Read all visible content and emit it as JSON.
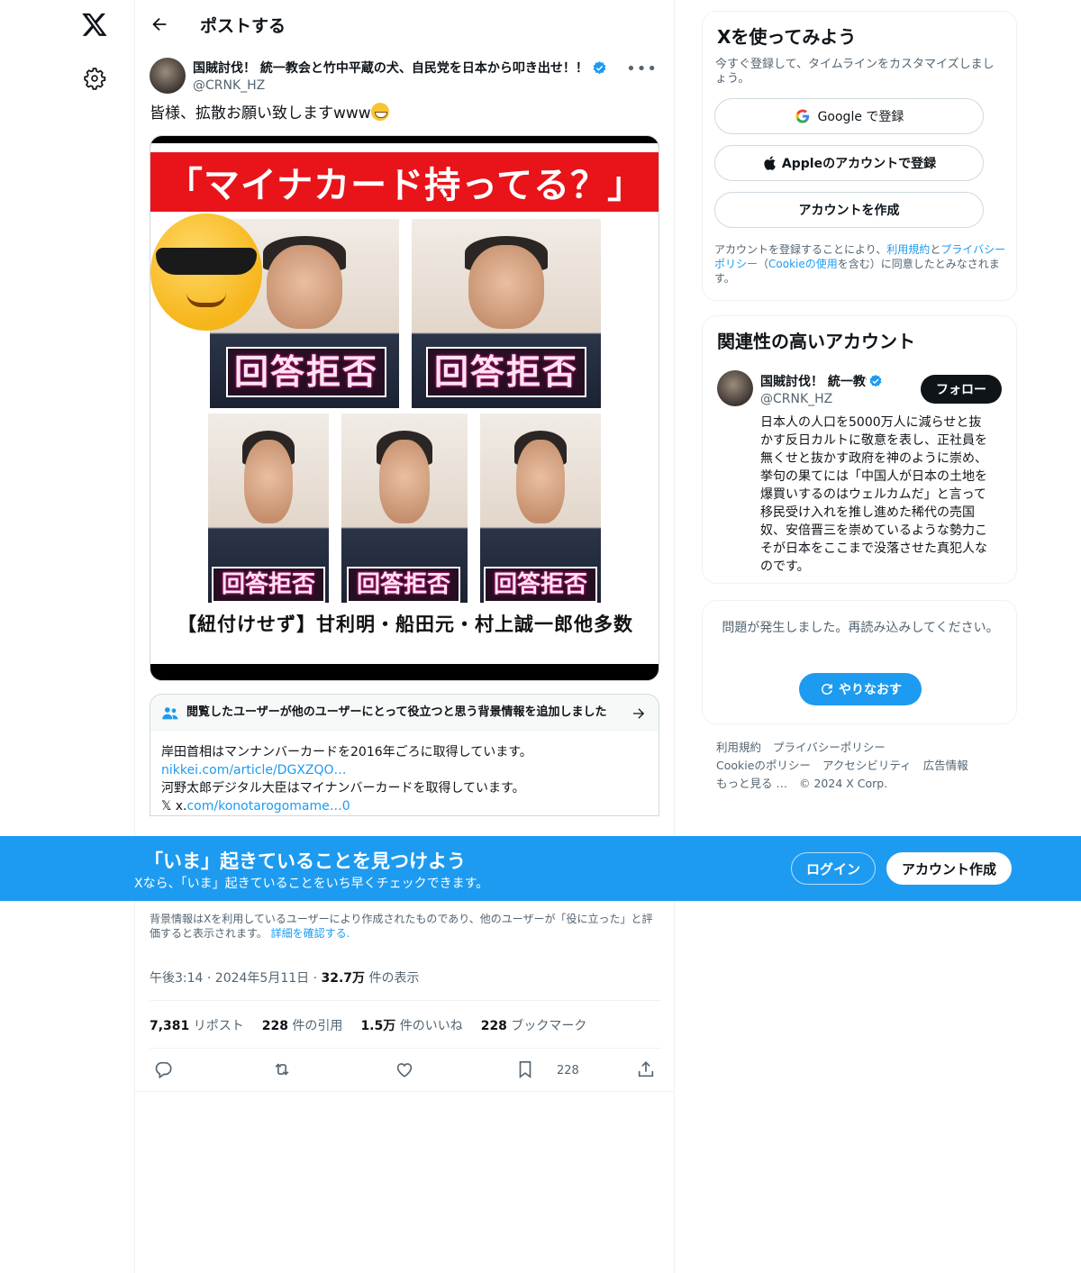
{
  "header": {
    "title": "ポストする"
  },
  "post": {
    "author_name": "国賊討伐！ 統一教会と竹中平蔵の犬、自民党を日本から叩き出せ！！",
    "handle": "@CRNK_HZ",
    "text": "皆様、拡散お願い致しますwww",
    "image": {
      "banner": "「マイナカード持ってる？」",
      "stamp": "回答拒否",
      "caption": "【紐付けせず】甘利明・船田元・村上誠一郎他多数"
    },
    "timestamp": "午後3:14 · 2024年5月11日 · ",
    "views_value": "32.7万",
    "views_label": " 件の表示",
    "stats": {
      "reposts_value": "7,381",
      "reposts_label": " リポスト",
      "quotes_value": "228",
      "quotes_label": " 件の引用",
      "likes_value": "1.5万",
      "likes_label": " 件のいいね",
      "bookmarks_value": "228",
      "bookmarks_label": " ブックマーク"
    },
    "bookmark_count": "228"
  },
  "note": {
    "title": "閲覧したユーザーが他のユーザーにとって役立つと思う背景情報を追加しました",
    "line1": "岸田首相はマンナンバーカードを2016年ごろに取得しています。",
    "link1": "nikkei.com/article/DGXZQO…",
    "line2": "河野太郎デジタル大臣はマイナンバーカードを取得しています。",
    "x_glyph": "𝕏",
    "link2_prefix": "x.",
    "link2": "com/konotarogomame…0",
    "footer_text": "背景情報はXを利用しているユーザーにより作成されたものであり、他のユーザーが「役に立った」と評価すると表示されます。",
    "footer_link": "詳細を確認する."
  },
  "promo": {
    "title": "「いま」起きていることを見つけよう",
    "subtitle": "Xなら、「いま」起きていることをいち早くチェックできます。",
    "login": "ログイン",
    "signup": "アカウント作成"
  },
  "signup_card": {
    "title": "Xを使ってみよう",
    "subtitle": "今すぐ登録して、タイムラインをカスタマイズしましょう。",
    "google": "Google で登録",
    "apple": "Appleのアカウントで登録",
    "create": "アカウントを作成",
    "legal_1": "アカウントを登録することにより、",
    "legal_terms": "利用規約",
    "legal_and": "と",
    "legal_privacy": "プライバシーポリシー",
    "legal_paren": "（",
    "legal_cookie": "Cookieの使用",
    "legal_2": "を含む）に同意したとみなされます。"
  },
  "related": {
    "title": "関連性の高いアカウント",
    "name": "国賊討伐！ 統一教会と竹中平蔵の犬、自民党を日本から叩き出せ！！",
    "handle": "@CRNK_HZ",
    "follow": "フォロー",
    "bio": "日本人の人口を5000万人に減らせと抜かす反日カルトに敬意を表し、正社員を無くせと抜かす政府を神のように崇め、挙句の果てには「中国人が日本の土地を爆買いするのはウェルカムだ」と言って移民受け入れを推し進めた稀代の売国奴、安倍晋三を崇めているような勢力こそが日本をここまで没落させた真犯人なのです。"
  },
  "error_card": {
    "message": "問題が発生しました。再読み込みしてください。",
    "retry": "やりなおす"
  },
  "footer": {
    "items": [
      "利用規約",
      "プライバシーポリシー",
      "Cookieのポリシー",
      "アクセシビリティ",
      "広告情報",
      "もっと見る …",
      "© 2024 X Corp."
    ]
  },
  "colors": {
    "accent": "#1d9bf0",
    "text": "#0f1419",
    "muted": "#536471"
  }
}
